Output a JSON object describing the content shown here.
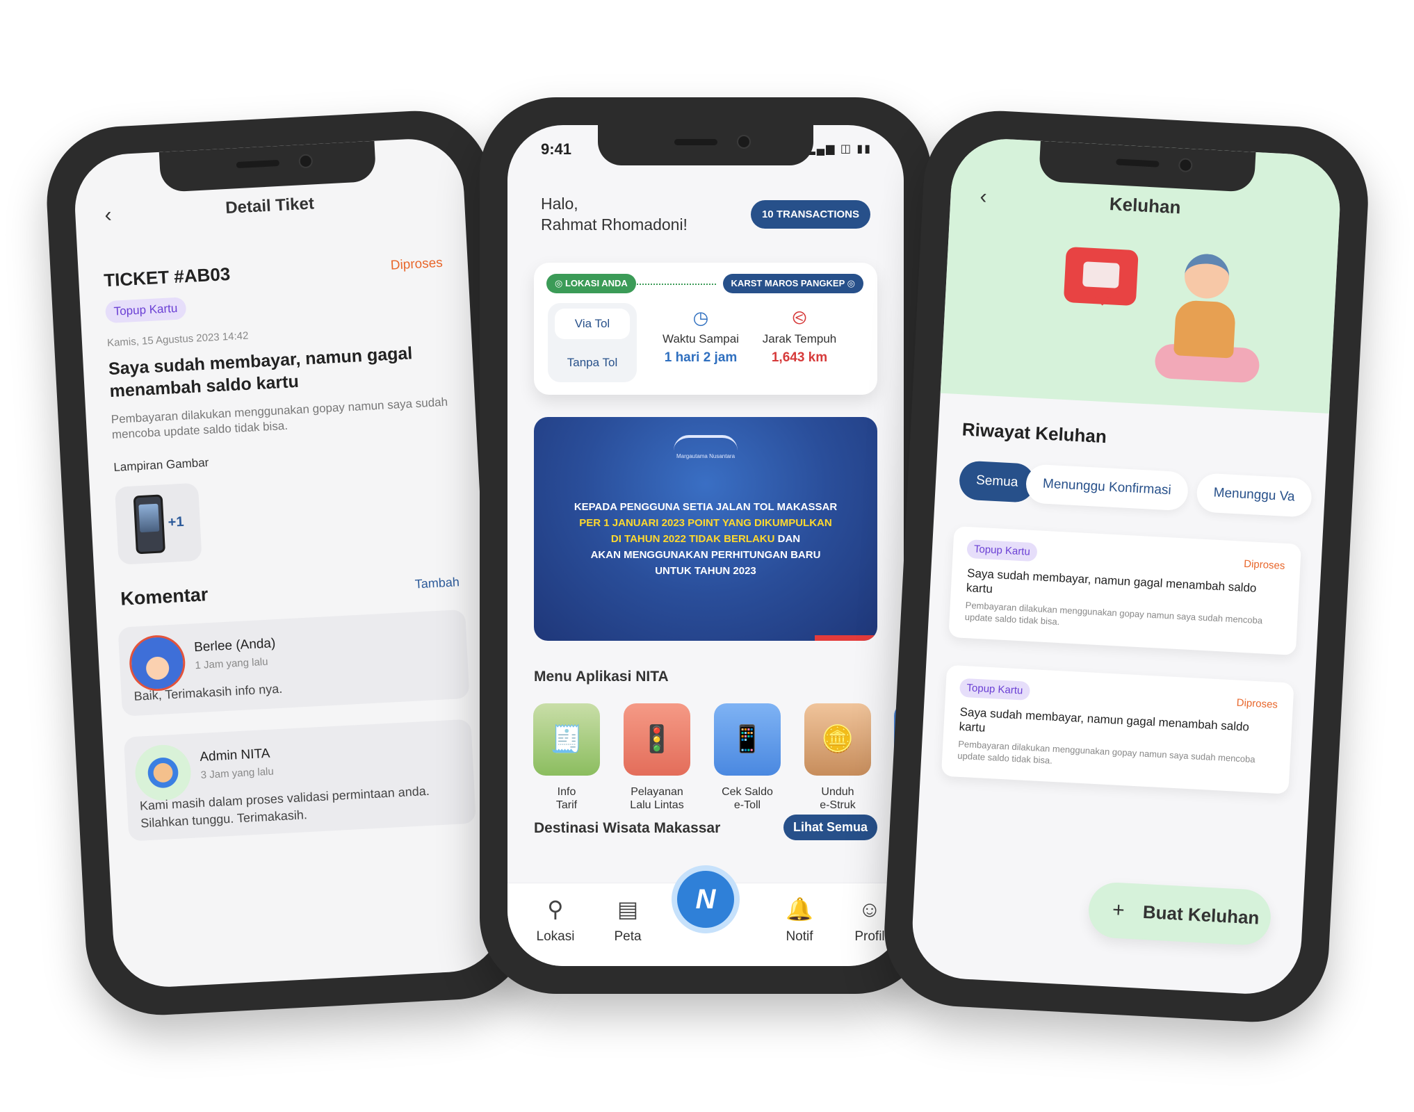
{
  "left": {
    "back_icon": "chevron-left-icon",
    "title": "Detail Tiket",
    "ticket_no": "TICKET #AB03",
    "status": "Diproses",
    "category": "Topup Kartu",
    "date": "Kamis, 15 Agustus 2023 14:42",
    "heading": "Saya sudah membayar, namun gagal menambah saldo kartu",
    "description": "Pembayaran dilakukan menggunakan gopay namun saya sudah mencoba update saldo tidak bisa.",
    "attachment_label": "Lampiran Gambar",
    "attachment_more": "+1",
    "comments_title": "Komentar",
    "comments_add": "Tambah",
    "comments": [
      {
        "name": "Berlee (Anda)",
        "time": "1 Jam yang lalu",
        "text": "Baik, Terimakasih info nya."
      },
      {
        "name": "Admin NITA",
        "time": "3 Jam yang lalu",
        "text": "Kami masih dalam proses validasi permintaan anda. Silahkan tunggu. Terimakasih."
      }
    ]
  },
  "center": {
    "status_time": "9:41",
    "greeting_line1": "Halo,",
    "greeting_line2": "Rahmat Rhomadoni!",
    "transactions_button": "10 TRANSACTIONS",
    "route": {
      "from": "LOKASI ANDA",
      "to": "KARST MAROS PANGKEP",
      "option_a": "Via Tol",
      "option_b": "Tanpa Tol",
      "time_label": "Waktu Sampai",
      "time_value": "1 hari 2 jam",
      "distance_label": "Jarak Tempuh",
      "distance_value": "1,643 km"
    },
    "banner": {
      "logo_text": "Margautama Nusantara",
      "line1": "KEPADA PENGGUNA SETIA JALAN TOL MAKASSAR",
      "line2": "PER 1 JANUARI 2023 POINT YANG DIKUMPULKAN",
      "line3a": "DI TAHUN 2022 TIDAK BERLAKU",
      "line3b": " DAN",
      "line4": "AKAN MENGGUNAKAN PERHITUNGAN BARU",
      "line5": "UNTUK TAHUN 2023"
    },
    "menu_title": "Menu Aplikasi NITA",
    "menu": [
      {
        "l1": "Info",
        "l2": "Tarif",
        "icon": "receipt-icon"
      },
      {
        "l1": "Pelayanan",
        "l2": "Lalu Lintas",
        "icon": "traffic-light-icon"
      },
      {
        "l1": "Cek Saldo",
        "l2": "e-Toll",
        "icon": "card-phone-icon"
      },
      {
        "l1": "Unduh",
        "l2": "e-Struk",
        "icon": "coin-receipt-icon"
      }
    ],
    "destinations_title": "Destinasi Wisata Makassar",
    "destinations_button": "Lihat Semua",
    "tabs": {
      "t1": "Lokasi",
      "t2": "Peta",
      "t4": "Notif",
      "t5": "Profil"
    }
  },
  "right": {
    "title": "Keluhan",
    "section": "Riwayat Keluhan",
    "filters": [
      "Semua",
      "Menunggu Konfirmasi",
      "Menunggu Va"
    ],
    "cards": [
      {
        "category": "Topup Kartu",
        "status": "Diproses",
        "title": "Saya sudah membayar, namun gagal menambah saldo kartu",
        "desc": "Pembayaran dilakukan menggunakan gopay namun saya sudah mencoba update saldo tidak bisa."
      },
      {
        "category": "Topup Kartu",
        "status": "Diproses",
        "title": "Saya sudah membayar, namun gagal menambah saldo kartu",
        "desc": "Pembayaran dilakukan menggunakan gopay namun saya sudah mencoba update saldo tidak bisa."
      }
    ],
    "fab_label": "Buat Keluhan"
  },
  "colors": {
    "primary": "#27508a",
    "status_orange": "#e8672c",
    "chip_purple": "#6a3fd4",
    "green": "#3b9b57",
    "hero_green": "#d6f2da"
  }
}
